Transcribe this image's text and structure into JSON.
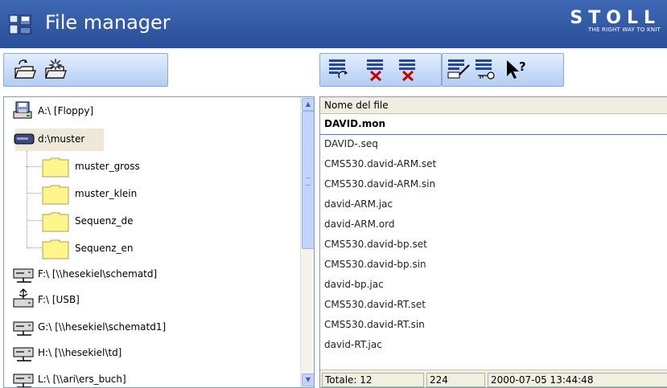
{
  "header": {
    "title": "File manager",
    "brand": "STOLL",
    "slogan": "THE RIGHT WAY TO KNIT"
  },
  "toolbar_left": {
    "buttons": [
      "refresh-folder-icon",
      "new-folder-icon"
    ]
  },
  "toolbar_right": {
    "buttons": [
      "refresh-list-icon",
      "delete-icon",
      "delete-all-icon",
      "properties-icon",
      "security-key-icon",
      "help-pointer-icon"
    ],
    "help_glyph": "?"
  },
  "tree": {
    "items": [
      {
        "label": "A:\\  [Floppy]",
        "icon": "floppy-drive-icon"
      },
      {
        "label": "d:\\muster",
        "icon": "hard-disk-icon",
        "selected": true
      },
      {
        "label": "muster_gross",
        "icon": "folder-icon"
      },
      {
        "label": "muster_klein",
        "icon": "folder-icon"
      },
      {
        "label": "Sequenz_de",
        "icon": "folder-icon"
      },
      {
        "label": "Sequenz_en",
        "icon": "folder-icon"
      },
      {
        "label": "F:\\  [\\\\hesekiel\\schematd]",
        "icon": "network-drive-icon"
      },
      {
        "label": "F:\\  [USB]",
        "icon": "usb-drive-icon"
      },
      {
        "label": "G:\\  [\\\\hesekiel\\schematd1]",
        "icon": "network-drive-icon"
      },
      {
        "label": "H:\\  [\\\\hesekiel\\td]",
        "icon": "network-drive-icon"
      },
      {
        "label": "L:\\  [\\\\ari\\ers_buch]",
        "icon": "network-drive-icon"
      }
    ]
  },
  "files": {
    "column_header": "Nome del file",
    "rows": [
      "DAVID.mon",
      "DAVID-.seq",
      "CMS530.david-ARM.set",
      "CMS530.david-ARM.sin",
      "david-ARM.jac",
      "david-ARM.ord",
      "CMS530.david-bp.set",
      "CMS530.david-bp.sin",
      "david-bp.jac",
      "CMS530.david-RT.set",
      "CMS530.david-RT.sin",
      "david-RT.jac"
    ],
    "selected_index": 0
  },
  "status": {
    "total_label": "Totale:  12",
    "size": "224",
    "datetime": "2000-07-05 13:44:48"
  },
  "colors": {
    "header_bg": "#2f57a4",
    "folder": "#fef68a",
    "selection_bg": "#ede8d8"
  }
}
